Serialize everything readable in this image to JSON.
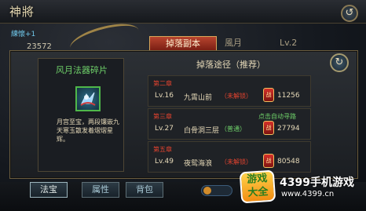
{
  "window": {
    "title": "神將",
    "exp_text": "練懷+1",
    "power_value": "23572"
  },
  "tabs": [
    {
      "label": "掉落副本"
    },
    {
      "label": "風月"
    },
    {
      "label": "Lv.2"
    }
  ],
  "item": {
    "name": "风月法器碎片",
    "icon": "magic-artifact-fragment-icon",
    "description": "月宫至宝，两段镶嵌九天寒玉散发着熠熠星辉。"
  },
  "drop_panel": {
    "header": "掉落途径（推荐）",
    "routes": [
      {
        "chapter": "第二章",
        "level": "Lv.16",
        "place": "九霄山前",
        "status": "（未解锁）",
        "pathing": "",
        "power": "11256"
      },
      {
        "chapter": "第三章",
        "level": "Lv.27",
        "place": "白骨洞三层",
        "status": "（普通）",
        "pathing": "点击自动寻路",
        "power": "27794"
      },
      {
        "chapter": "第五章",
        "level": "Lv.49",
        "place": "夜鸳海浪",
        "status": "（未解锁）",
        "pathing": "",
        "power": "80548"
      }
    ]
  },
  "bottom_tabs": [
    {
      "label": "法宝"
    },
    {
      "label": "属性"
    },
    {
      "label": "背包"
    }
  ],
  "watermark": {
    "logo_top": "游戏",
    "logo_bottom": "大全",
    "title": "4399手机游戏",
    "url": "www.4399.cn"
  },
  "colors": {
    "locked": "#e2432f",
    "open": "#6fd26a",
    "accent": "#b8442e"
  }
}
